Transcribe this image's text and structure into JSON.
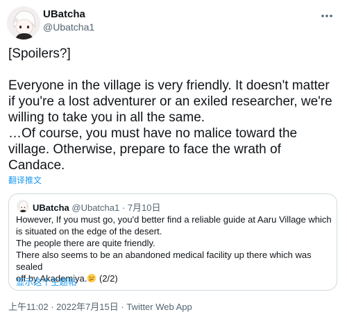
{
  "author": {
    "display_name": "UBatcha",
    "handle": "@Ubatcha1",
    "avatar_icon": "chibi-avatar-icon"
  },
  "more_icon": "more-dots-icon",
  "tweet": {
    "text": "[Spoilers?]\n\nEveryone in the village is very friendly. It doesn't matter\nif you're a lost adventurer or an exiled researcher, we're\nwilling to take you in all the same.\n…Of course, you must have no malice toward the\nvillage. Otherwise, prepare to face the wrath of\nCandace.",
    "translate_label": "翻译推文"
  },
  "quoted_tweet": {
    "display_name": "UBatcha",
    "handle": "@Ubatcha1",
    "separator": "·",
    "date": "7月10日",
    "text_main": "However, If you must go, you'd better find a reliable guide at Aaru Village which\nis situated on the edge of the desert.\nThe people there are quite friendly.\nThere also seems to be an abandoned medical facility up there which was sealed\noff by Akademiya.",
    "emoji_icon": "thinking-face-icon",
    "text_suffix": " (2/2)",
    "show_thread_label": "显示这个主题帖"
  },
  "meta": {
    "time": "上午11:02",
    "separator_1": " · ",
    "date": "2022年7月15日",
    "separator_2": " · ",
    "client": "Twitter Web App"
  },
  "colors": {
    "link": "#1d9bf0",
    "secondary_text": "#536471",
    "border": "#cfd9de"
  }
}
